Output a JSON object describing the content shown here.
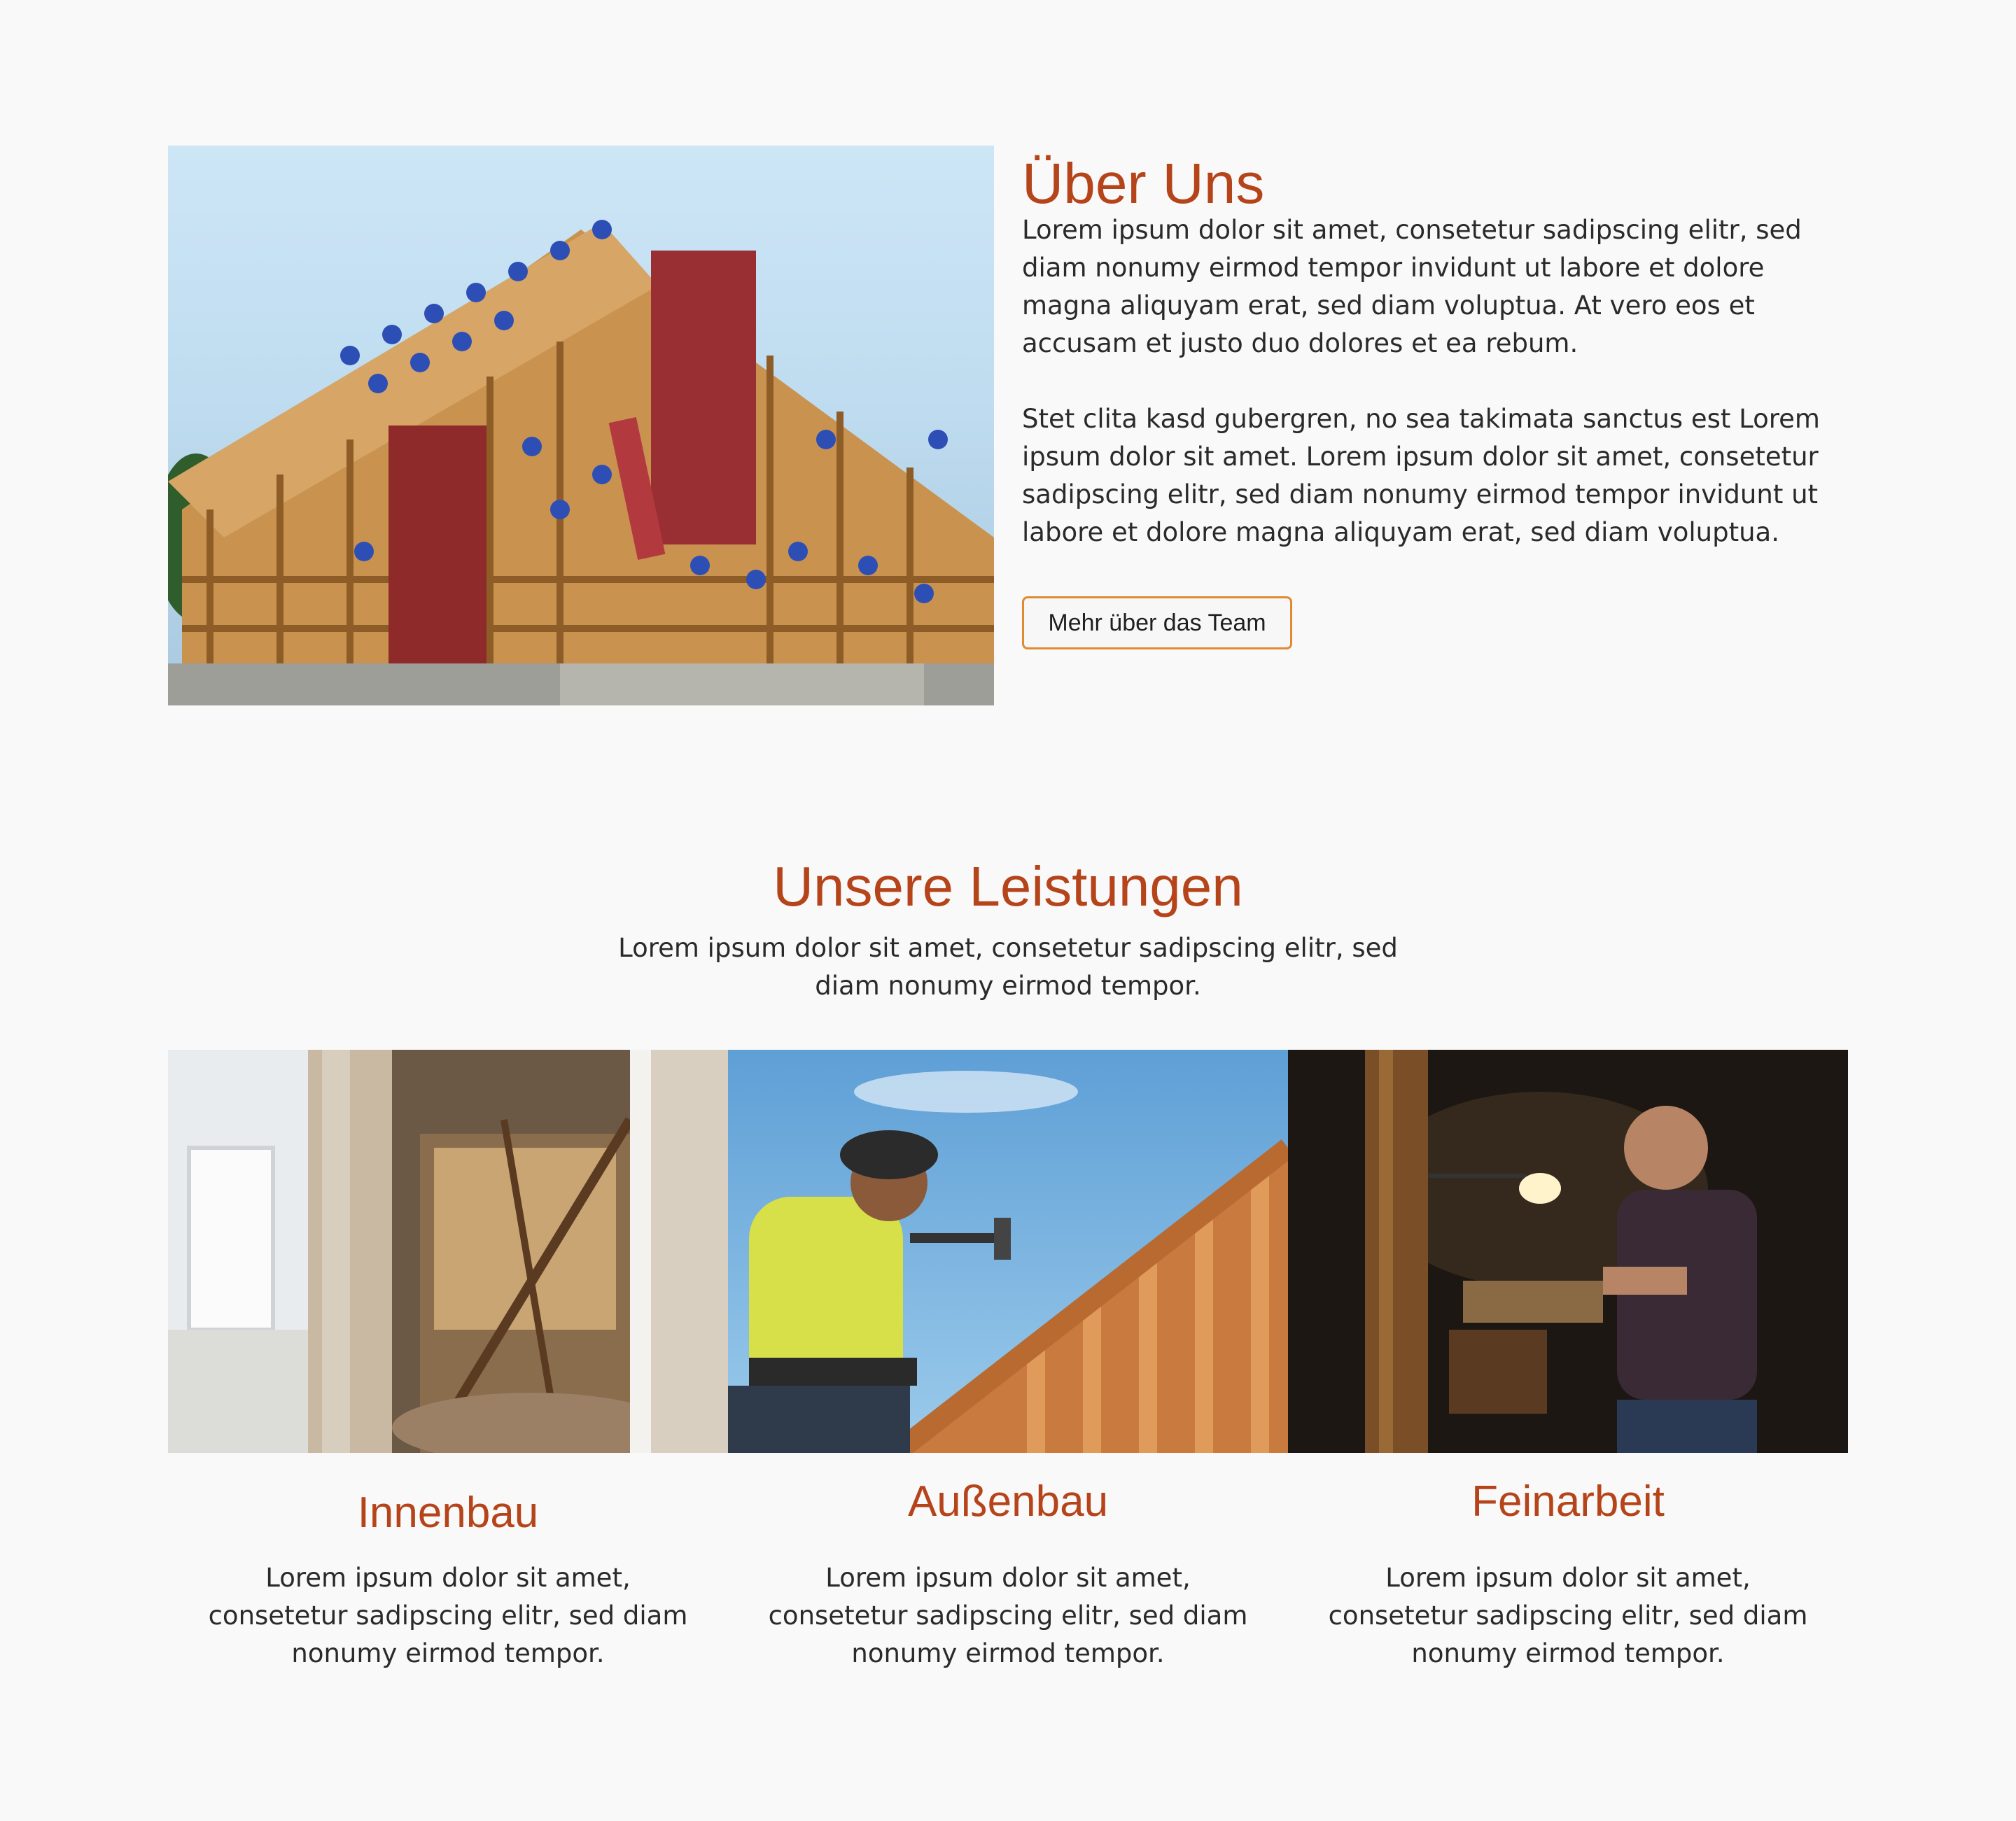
{
  "about": {
    "title": "Über Uns",
    "paragraphs": [
      "Lorem ipsum dolor sit amet, consetetur sadipscing elitr, sed diam nonumy eirmod tempor invidunt ut labore et dolore magna aliquyam erat, sed diam voluptua. At vero eos et accusam et justo duo dolores et ea rebum.",
      "Stet clita kasd gubergren, no sea takimata sanctus est Lorem ipsum dolor sit amet. Lorem ipsum dolor sit amet, consetetur sadipscing elitr, sed diam nonumy eirmod tempor invidunt ut labore et dolore magna aliquyam erat, sed diam voluptua."
    ],
    "button_label": "Mehr über das Team"
  },
  "services": {
    "title": "Unsere Leistungen",
    "intro": "Lorem ipsum dolor sit amet, consetetur sadipscing elitr, sed diam nonumy eirmod tempor.",
    "items": [
      {
        "title": "Innenbau",
        "text": "Lorem ipsum dolor sit amet, consetetur sadipscing elitr, sed diam nonumy eirmod tempor."
      },
      {
        "title": "Außenbau",
        "text": "Lorem ipsum dolor sit amet, consetetur sadipscing elitr, sed diam nonumy eirmod tempor."
      },
      {
        "title": "Feinarbeit",
        "text": "Lorem ipsum dolor sit amet, consetetur sadipscing elitr, sed diam nonumy eirmod tempor."
      }
    ]
  },
  "colors": {
    "accent": "#b6441a",
    "button_border": "#e08a32",
    "background": "#f9f9f9",
    "text": "#2a2a2a"
  }
}
